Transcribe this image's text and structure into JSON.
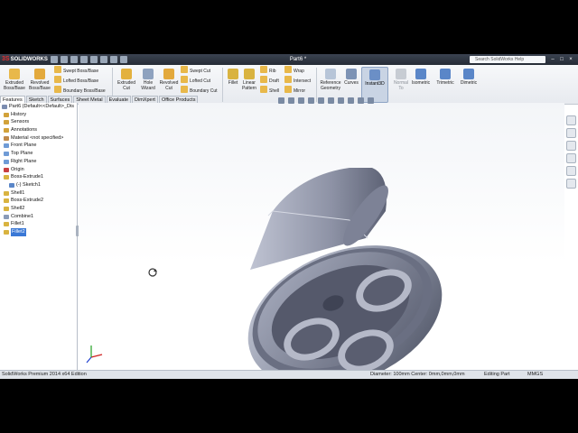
{
  "app": {
    "brand": "SOLIDWORKS",
    "document_title": "Part6 *",
    "help_search_placeholder": "Search SolidWorks Help",
    "window_controls": [
      "–",
      "□",
      "×"
    ]
  },
  "command_manager": {
    "features": {
      "extruded_boss": "Extruded\nBoss/Base",
      "revolved_boss": "Revolved\nBoss/Base",
      "swept_boss": "Swept Boss/Base",
      "lofted_boss": "Lofted Boss/Base",
      "boundary_boss": "Boundary Boss/Base",
      "extruded_cut": "Extruded\nCut",
      "hole_wizard": "Hole\nWizard",
      "revolved_cut": "Revolved\nCut",
      "swept_cut": "Swept Cut",
      "lofted_cut": "Lofted Cut",
      "boundary_cut": "Boundary Cut",
      "fillet": "Fillet",
      "linear_pattern": "Linear\nPattern",
      "rib": "Rib",
      "draft": "Draft",
      "shell": "Shell",
      "wrap": "Wrap",
      "intersect": "Intersect",
      "mirror": "Mirror",
      "reference_geometry": "Reference\nGeometry",
      "curves": "Curves",
      "instant3d": "Instant3D",
      "normal_to": "Normal\nTo",
      "isometric": "Isometric",
      "trimetric": "Trimetric",
      "dimetric": "Dimetric"
    },
    "tabs": [
      "Features",
      "Sketch",
      "Surfaces",
      "Sheet Metal",
      "Evaluate",
      "DimXpert",
      "Office Products"
    ]
  },
  "feature_tree": {
    "items": [
      {
        "label": "Part6  (Default<<Default>_Dis",
        "icon": "part-icon"
      },
      {
        "label": "History",
        "icon": "history-icon"
      },
      {
        "label": "Sensors",
        "icon": "sensors-icon"
      },
      {
        "label": "Annotations",
        "icon": "annotations-icon"
      },
      {
        "label": "Material <not specified>",
        "icon": "material-icon"
      },
      {
        "label": "Front Plane",
        "icon": "plane-icon"
      },
      {
        "label": "Top Plane",
        "icon": "plane-icon"
      },
      {
        "label": "Right Plane",
        "icon": "plane-icon"
      },
      {
        "label": "Origin",
        "icon": "origin-icon"
      },
      {
        "label": "Boss-Extrude1",
        "icon": "extrude-icon"
      },
      {
        "label": "(-) Sketch1",
        "icon": "sketch-icon"
      },
      {
        "label": "Shell1",
        "icon": "shell-icon"
      },
      {
        "label": "Boss-Extrude2",
        "icon": "extrude-icon"
      },
      {
        "label": "Shell2",
        "icon": "shell-icon"
      },
      {
        "label": "Combine1",
        "icon": "combine-icon"
      },
      {
        "label": "Fillet1",
        "icon": "fillet-icon"
      },
      {
        "label": "Fillet2",
        "icon": "fillet-icon"
      }
    ],
    "selected_index": 16
  },
  "status_bar": {
    "edition": "SolidWorks Premium 2014 x64 Edition",
    "measure": "Diameter: 100mm  Center: 0mm,0mm,0mm",
    "mode": "Editing Part",
    "units": "MMGS"
  },
  "colors": {
    "accent": "#3a78d6",
    "titlebar": "#2c323c",
    "model_metal": "#8e94a6"
  }
}
